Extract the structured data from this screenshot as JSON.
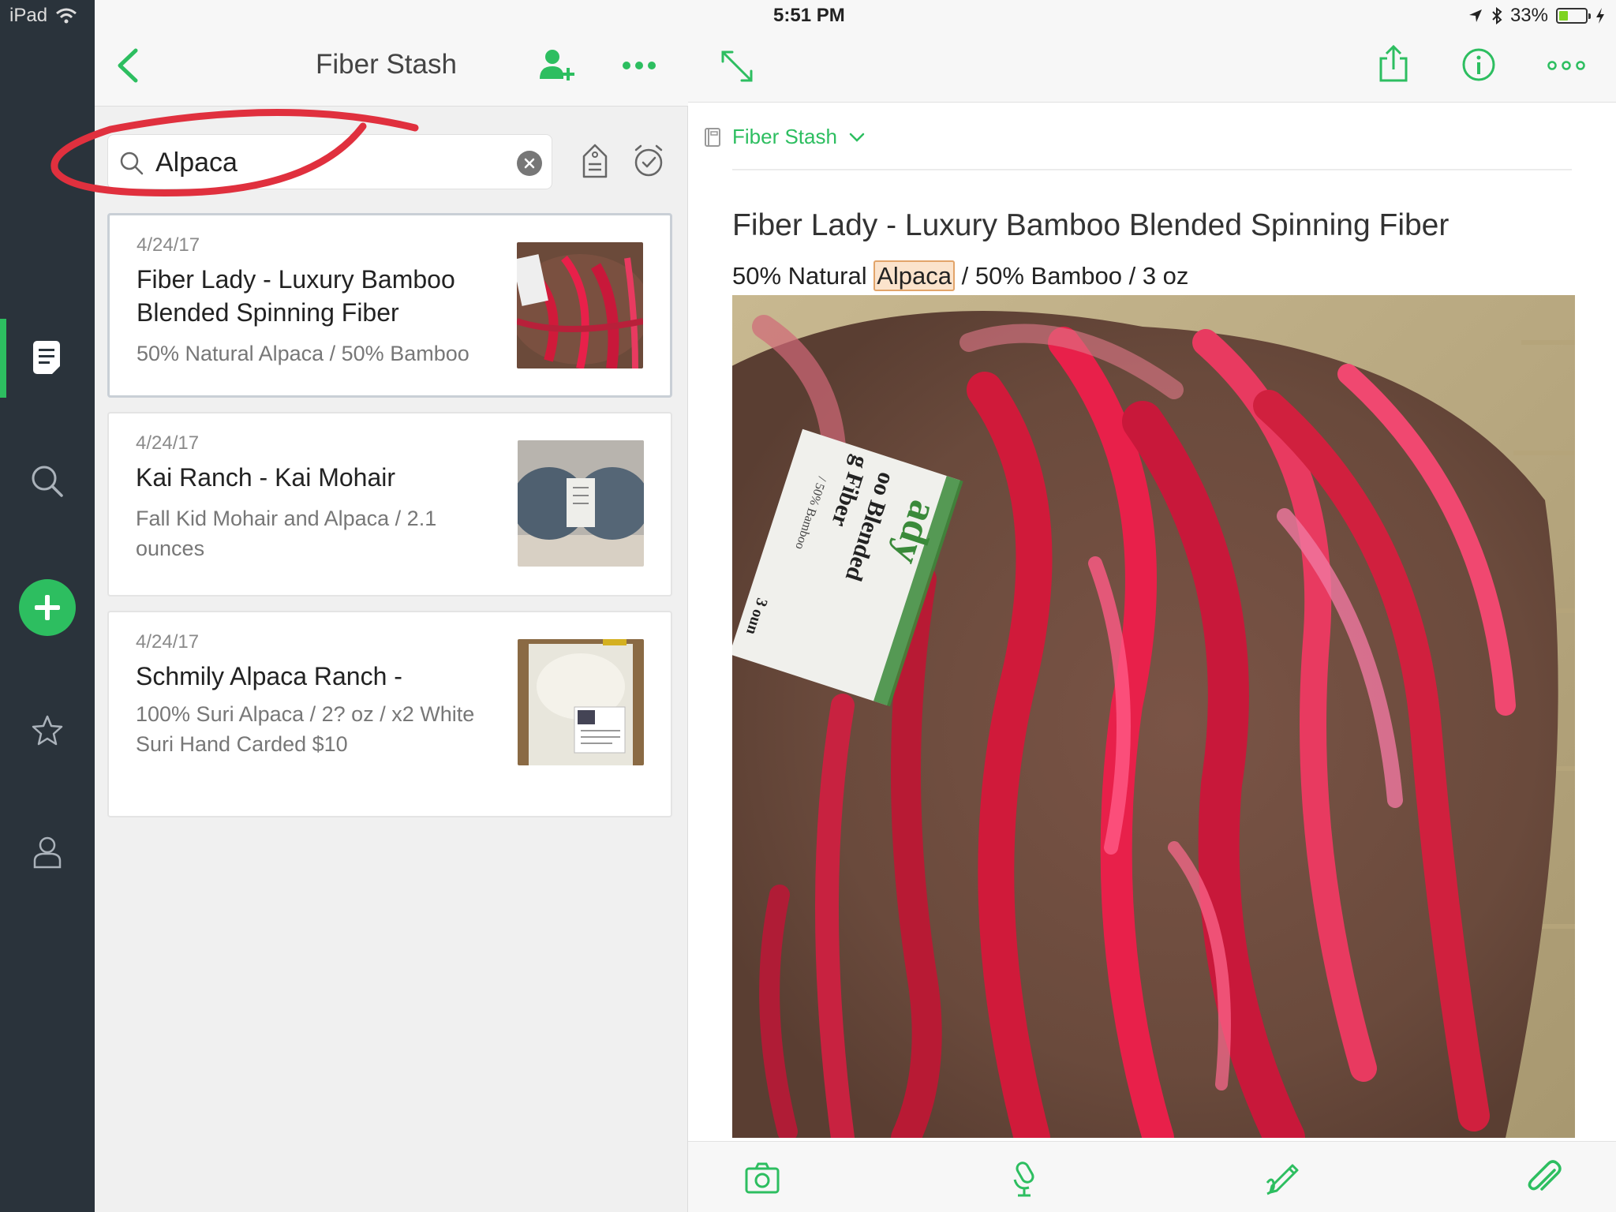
{
  "status_bar": {
    "device": "iPad",
    "time": "5:51 PM",
    "battery": "33%",
    "battery_level": 0.33
  },
  "colors": {
    "accent": "#2dbe60",
    "rail": "#2a333b",
    "annotation": "#e0303e"
  },
  "rail": {
    "items": [
      "notes-icon",
      "search-icon",
      "add-icon",
      "star-icon",
      "person-icon"
    ],
    "active": "notes-icon"
  },
  "list": {
    "title": "Fiber Stash",
    "search": {
      "value": "Alpaca",
      "placeholder": ""
    },
    "notes": [
      {
        "date": "4/24/17",
        "title": "Fiber Lady - Luxury Bamboo Blended Spinning Fiber",
        "snippet": "50% Natural Alpaca / 50% Bamboo",
        "selected": true
      },
      {
        "date": "4/24/17",
        "title": "Kai Ranch - Kai Mohair",
        "snippet": "Fall Kid Mohair and Alpaca / 2.1 ounces",
        "selected": false
      },
      {
        "date": "4/24/17",
        "title": "Schmily Alpaca Ranch -",
        "snippet": "100% Suri Alpaca / 2? oz / x2 White Suri Hand Carded $10",
        "selected": false
      }
    ]
  },
  "detail": {
    "notebook": "Fiber Stash",
    "title": "Fiber Lady - Luxury Bamboo Blended Spinning Fiber",
    "line_before": "50% Natural ",
    "line_highlight": "Alpaca",
    "line_after": " / 50% Bamboo / 3 oz",
    "label_text": {
      "brand": "ady",
      "line1": "oo Blended",
      "line2": "g Fiber",
      "line3": "/ 50% Bamboo",
      "line4": "3 oun"
    },
    "bottom_bar": [
      "camera-icon",
      "audio-icon",
      "handwriting-icon",
      "attachment-icon"
    ]
  }
}
